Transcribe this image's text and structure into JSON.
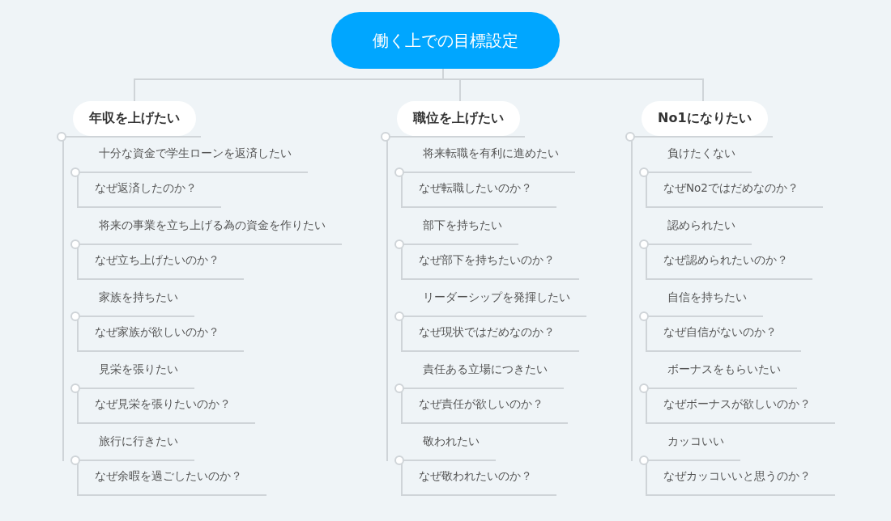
{
  "central_topic": {
    "label": "働く上での目標設定"
  },
  "branches": [
    {
      "label": "年収を上げたい",
      "children": [
        {
          "label": "十分な資金で学生ローンを返済したい",
          "children": [
            {
              "label": "なぜ返済したのか？"
            }
          ]
        },
        {
          "label": "将来の事業を立ち上げる為の資金を作りたい",
          "children": [
            {
              "label": "なぜ立ち上げたいのか？"
            }
          ]
        },
        {
          "label": "家族を持ちたい",
          "children": [
            {
              "label": "なぜ家族が欲しいのか？"
            }
          ]
        },
        {
          "label": "見栄を張りたい",
          "children": [
            {
              "label": "なぜ見栄を張りたいのか？"
            }
          ]
        },
        {
          "label": "旅行に行きたい",
          "children": [
            {
              "label": "なぜ余暇を過ごしたいのか？"
            }
          ]
        }
      ]
    },
    {
      "label": "職位を上げたい",
      "children": [
        {
          "label": "将来転職を有利に進めたい",
          "children": [
            {
              "label": "なぜ転職したいのか？"
            }
          ]
        },
        {
          "label": "部下を持ちたい",
          "children": [
            {
              "label": "なぜ部下を持ちたいのか？"
            }
          ]
        },
        {
          "label": "リーダーシップを発揮したい",
          "children": [
            {
              "label": "なぜ現状ではだめなのか？"
            }
          ]
        },
        {
          "label": "責任ある立場につきたい",
          "children": [
            {
              "label": "なぜ責任が欲しいのか？"
            }
          ]
        },
        {
          "label": "敬われたい",
          "children": [
            {
              "label": "なぜ敬われたいのか？"
            }
          ]
        }
      ]
    },
    {
      "label": "No1になりたい",
      "children": [
        {
          "label": "負けたくない",
          "children": [
            {
              "label": "なぜNo2ではだめなのか？"
            }
          ]
        },
        {
          "label": "認められたい",
          "children": [
            {
              "label": "なぜ認められたいのか？"
            }
          ]
        },
        {
          "label": "自信を持ちたい",
          "children": [
            {
              "label": "なぜ自信がないのか？"
            }
          ]
        },
        {
          "label": "ボーナスをもらいたい",
          "children": [
            {
              "label": "なぜボーナスが欲しいのか？"
            }
          ]
        },
        {
          "label": "カッコいい",
          "children": [
            {
              "label": "なぜカッコいいと思うのか？"
            }
          ]
        }
      ]
    }
  ]
}
